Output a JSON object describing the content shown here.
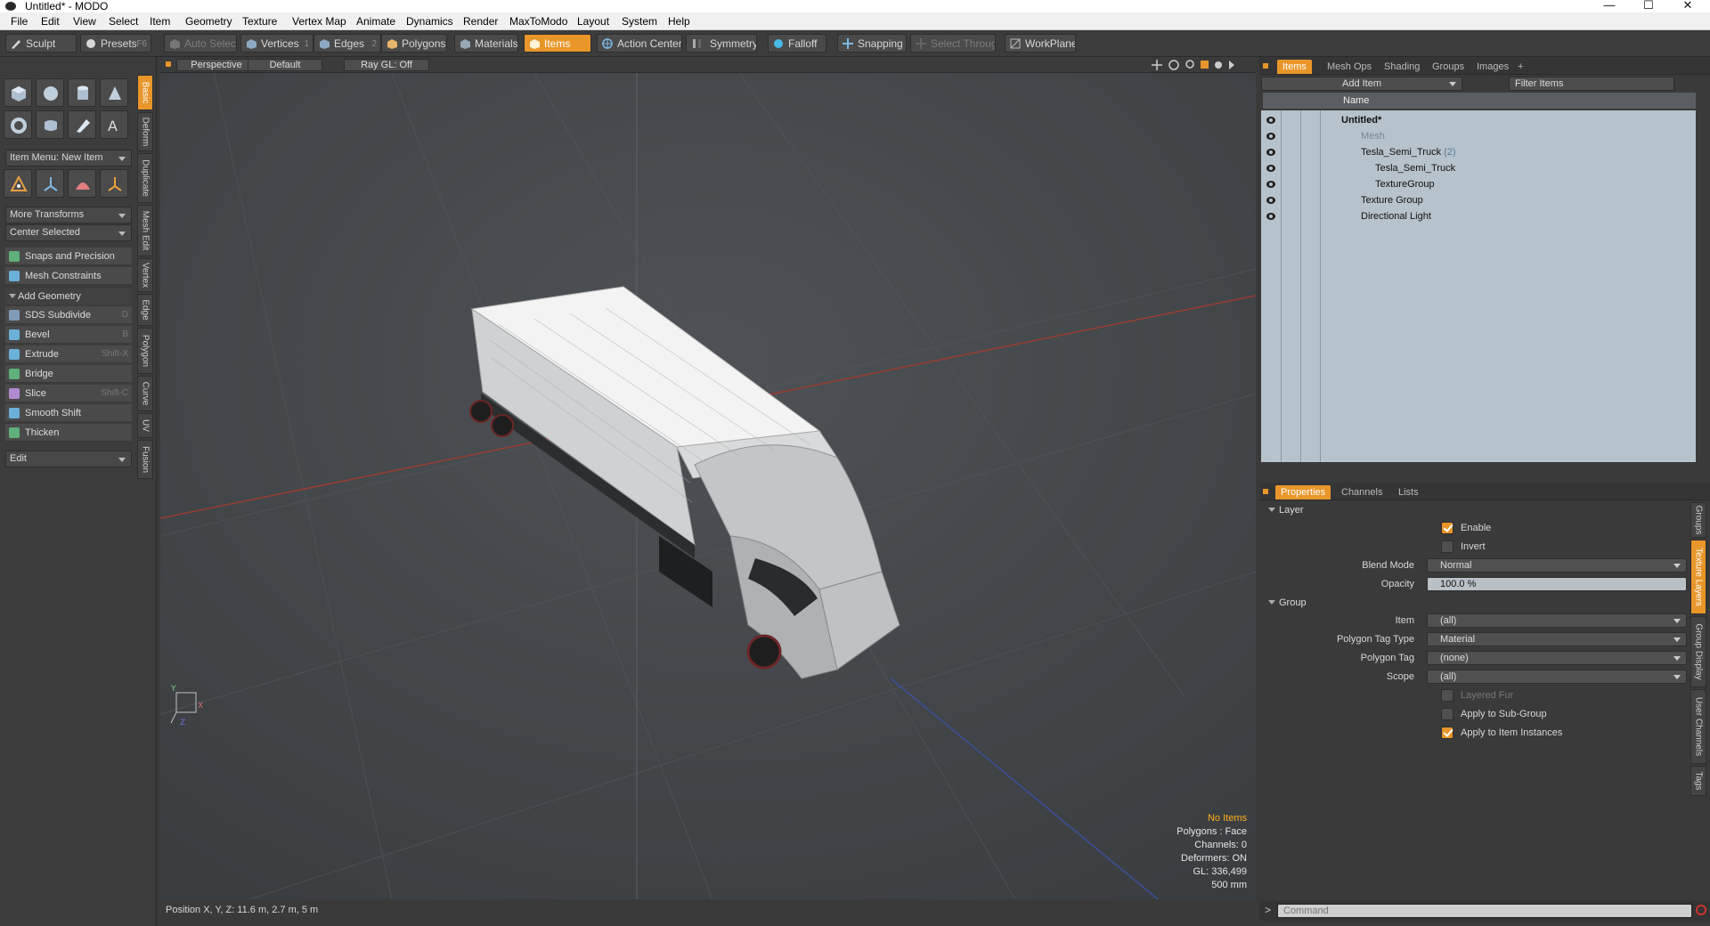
{
  "window": {
    "title": "Untitled* - MODO"
  },
  "menu": [
    "File",
    "Edit",
    "View",
    "Select",
    "Item",
    "Geometry",
    "Texture",
    "Vertex Map",
    "Animate",
    "Dynamics",
    "Render",
    "MaxToModo",
    "Layout",
    "System",
    "Help"
  ],
  "toolbar": {
    "sculpt": "Sculpt",
    "presets": "Presets",
    "presets_hotkey": "F6",
    "auto_select": "Auto Select",
    "vertices": "Vertices",
    "vertices_hotkey": "1",
    "edges": "Edges",
    "edges_hotkey": "2",
    "polygons": "Polygons",
    "materials": "Materials",
    "items": "Items",
    "action_center": "Action Center",
    "symmetry": "Symmetry",
    "falloff": "Falloff",
    "snapping": "Snapping",
    "select_through": "Select Through",
    "workplane": "WorkPlane"
  },
  "left": {
    "item_menu": "Item Menu: New Item",
    "more_transforms": "More Transforms",
    "center_selected": "Center Selected",
    "snaps": "Snaps and Precision",
    "mesh_constraints": "Mesh Constraints",
    "add_geometry": "Add Geometry",
    "tools": [
      {
        "label": "SDS Subdivide",
        "hotkey": "D",
        "color": "#7f9bb8"
      },
      {
        "label": "Bevel",
        "hotkey": "B",
        "color": "#6ab0d8"
      },
      {
        "label": "Extrude",
        "hotkey": "Shift-X",
        "color": "#6ab0d8"
      },
      {
        "label": "Bridge",
        "hotkey": "",
        "color": "#6ab0d8"
      },
      {
        "label": "Slice",
        "hotkey": "Shift-C",
        "color": "#b08ad0"
      },
      {
        "label": "Smooth Shift",
        "hotkey": "",
        "color": "#6ab0d8"
      },
      {
        "label": "Thicken",
        "hotkey": "",
        "color": "#6ab0d8"
      }
    ],
    "edit_menu": "Edit"
  },
  "vtabs": [
    "Basic",
    "Deform",
    "Duplicate",
    "Mesh Edit",
    "Vertex",
    "Edge",
    "Polygon",
    "Curve",
    "UV",
    "Fusion"
  ],
  "viewport": {
    "perspective": "Perspective",
    "default": "Default",
    "raygl": "Ray GL: Off",
    "stats": {
      "no_items": "No Items",
      "polygons": "Polygons : Face",
      "channels": "Channels: 0",
      "deformers": "Deformers: ON",
      "gl": "GL: 336,499",
      "scale": "500 mm"
    },
    "axis": {
      "y": "Y",
      "x": "X",
      "z": "Z"
    }
  },
  "status": {
    "position": "Position X, Y, Z:  11.6 m, 2.7 m, 5 m"
  },
  "items_panel": {
    "tabs": [
      "Items",
      "Mesh Ops",
      "Shading",
      "Groups",
      "Images"
    ],
    "add_item": "Add Item",
    "filter": "Filter Items",
    "name_col": "Name",
    "rows": [
      {
        "label": "Untitled*",
        "count": ""
      },
      {
        "label": "Mesh",
        "count": ""
      },
      {
        "label": "Tesla_Semi_Truck",
        "count": "(2)"
      },
      {
        "label": "Tesla_Semi_Truck",
        "count": ""
      },
      {
        "label": "TextureGroup",
        "count": ""
      },
      {
        "label": "Texture Group",
        "count": ""
      },
      {
        "label": "Directional Light",
        "count": ""
      }
    ]
  },
  "properties_panel": {
    "tabs": [
      "Properties",
      "Channels",
      "Lists"
    ],
    "layer": "Layer",
    "enable": "Enable",
    "invert": "Invert",
    "blend_mode_label": "Blend Mode",
    "blend_mode": "Normal",
    "opacity_label": "Opacity",
    "opacity": "100.0 %",
    "group": "Group",
    "item_label": "Item",
    "item_value": "(all)",
    "ptag_type_label": "Polygon Tag Type",
    "ptag_type": "Material",
    "ptag_label": "Polygon Tag",
    "ptag": "(none)",
    "scope_label": "Scope",
    "scope": "(all)",
    "layered_fur": "Layered Fur",
    "apply_sub": "Apply to Sub-Group",
    "apply_inst": "Apply to Item Instances"
  },
  "right_vtabs": [
    "Groups",
    "Texture Layers",
    "Group Display",
    "User Channels",
    "Tags"
  ],
  "command": {
    "placeholder": "Command"
  }
}
